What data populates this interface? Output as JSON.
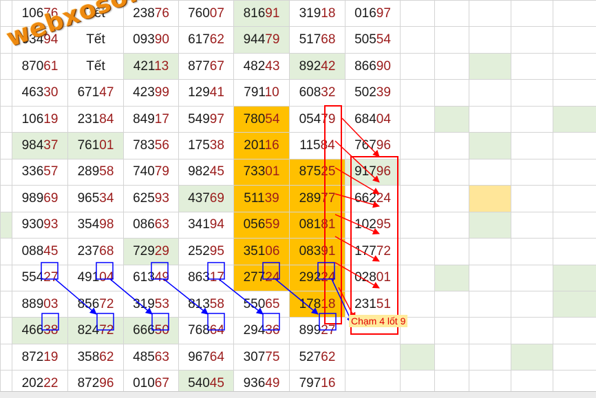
{
  "rows": [
    [
      "10676",
      "Tết",
      "23876",
      "76007",
      "81691",
      "31918",
      "01697"
    ],
    [
      "93494",
      "Tết",
      "09390",
      "61762",
      "94479",
      "51768",
      "50554"
    ],
    [
      "87061",
      "Tết",
      "42113",
      "87767",
      "48243",
      "89242",
      "86690"
    ],
    [
      "46330",
      "67147",
      "42399",
      "12941",
      "79110",
      "60832",
      "50239"
    ],
    [
      "10619",
      "23184",
      "84917",
      "54997",
      "78054",
      "05479",
      "68404"
    ],
    [
      "98437",
      "76101",
      "78356",
      "17538",
      "20116",
      "11584",
      "76796"
    ],
    [
      "33657",
      "28958",
      "74079",
      "98245",
      "73301",
      "87525",
      "91796"
    ],
    [
      "98969",
      "96534",
      "62593",
      "43769",
      "51139",
      "28977",
      "66224"
    ],
    [
      "93093",
      "35498",
      "08663",
      "34194",
      "05659",
      "08181",
      "10295"
    ],
    [
      "08845",
      "23768",
      "72929",
      "25295",
      "35106",
      "08391",
      "17772"
    ],
    [
      "55427",
      "49104",
      "61349",
      "86317",
      "27724",
      "29224",
      "02801"
    ],
    [
      "88903",
      "85672",
      "31953",
      "81358",
      "55065",
      "17818",
      "23151"
    ],
    [
      "46638",
      "82472",
      "66650",
      "76864",
      "29436",
      "89927",
      ""
    ],
    [
      "87219",
      "35862",
      "48563",
      "96764",
      "30775",
      "52762",
      ""
    ],
    [
      "20222",
      "87296",
      "01067",
      "54045",
      "93649",
      "79716",
      ""
    ]
  ],
  "watermark": "webxoso.net",
  "annotation": "Chạm 4 lốt 9",
  "colors": {
    "grid_line": "#d4d4d4",
    "green_fill": "#e2efda",
    "orange_fill": "#ffc000",
    "light_yellow_fill": "#ffe699",
    "red_mark": "#ff0000",
    "blue_mark": "#0000ff",
    "ending_digits": "#9b1b1b",
    "watermark": "#ee8a10"
  }
}
